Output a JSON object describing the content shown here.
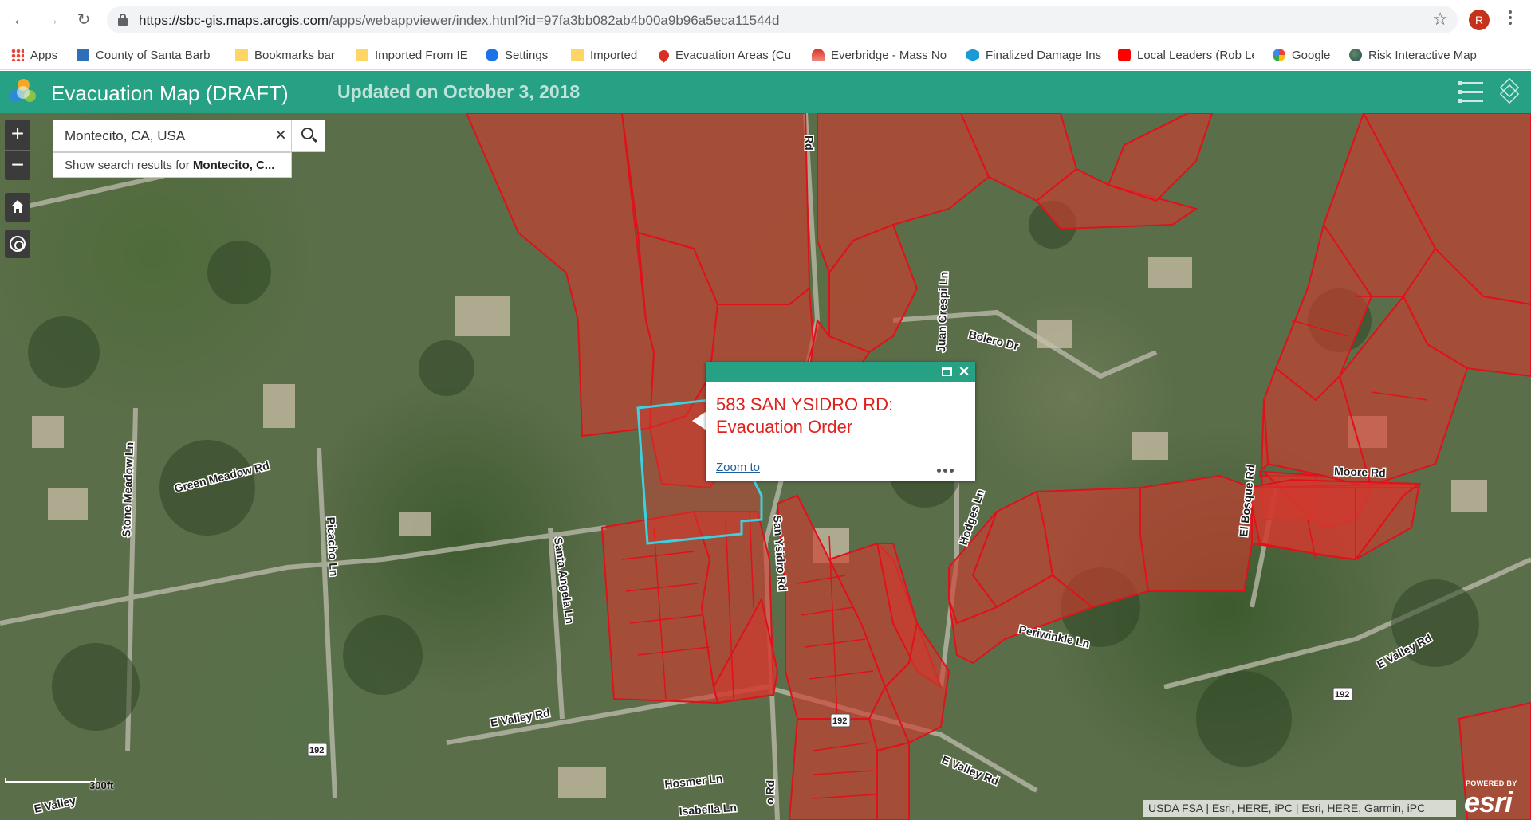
{
  "browser": {
    "url_host": "https://sbc-gis.maps.arcgis.com",
    "url_path": "/apps/webappviewer/index.html?id=97fa3bb082ab4b00a9b96a5eca11544d",
    "profile_initial": "R"
  },
  "bookmarks": [
    {
      "label": "Apps",
      "icon": "apps-grid-icon"
    },
    {
      "label": "County of Santa Barb",
      "icon": "county-icon"
    },
    {
      "label": "Bookmarks bar",
      "icon": "folder-icon"
    },
    {
      "label": "Imported From IE",
      "icon": "folder-icon"
    },
    {
      "label": "Settings",
      "icon": "gear-icon"
    },
    {
      "label": "Imported",
      "icon": "folder-icon"
    },
    {
      "label": "Evacuation Areas (Cu",
      "icon": "map-pin-icon"
    },
    {
      "label": "Everbridge - Mass No",
      "icon": "everbridge-icon"
    },
    {
      "label": "Finalized Damage Ins",
      "icon": "finalized-icon"
    },
    {
      "label": "Local Leaders (Rob Le",
      "icon": "youtube-icon"
    },
    {
      "label": "Google",
      "icon": "google-icon"
    },
    {
      "label": "Risk Interactive Map",
      "icon": "globe-icon"
    }
  ],
  "app": {
    "title": "Evacuation Map (DRAFT)",
    "subtitle": "Updated on October 3, 2018",
    "header_color": "#26a184"
  },
  "search": {
    "value": "Montecito, CA, USA",
    "suggest_prefix": "Show search results for ",
    "suggest_bold": "Montecito, C..."
  },
  "popup": {
    "title": "583 SAN YSIDRO RD: Evacuation Order",
    "zoom_link": "Zoom to"
  },
  "map": {
    "evac_fill": "#d23a2e",
    "evac_stroke": "#e0111a",
    "selected_stroke": "#3fd0e0",
    "road_labels": [
      "Rd",
      "Juan Crespi Ln",
      "Bolero Dr",
      "Green Meadow Rd",
      "Stone Meadow Ln",
      "Picacho Ln",
      "Santa Angela Ln",
      "San Ysidro Rd",
      "Hodges Ln",
      "El Bosque Rd",
      "Moore Rd",
      "Periwinkle Ln",
      "E Valley Rd",
      "E Valley Rd",
      "E Valley Rd",
      "Hosmer Ln",
      "Isabella Ln",
      "E Valley",
      "o Rd"
    ],
    "shields": [
      "192",
      "192",
      "192"
    ],
    "scale_label": "300ft",
    "attribution": "USDA FSA | Esri, HERE, iPC | Esri, HERE, Garmin, iPC",
    "esri_powered": "POWERED BY",
    "esri_word": "esri"
  }
}
